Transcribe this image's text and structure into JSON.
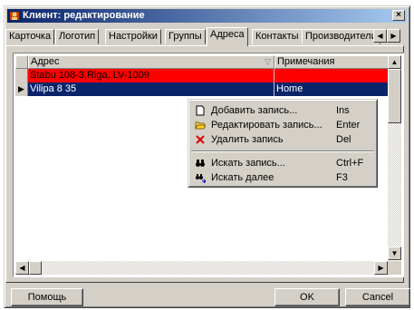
{
  "window": {
    "title": "Клиент: редактирование"
  },
  "tabs": [
    {
      "label": "Карточка"
    },
    {
      "label": "Логотип"
    },
    {
      "label": "Настройки"
    },
    {
      "label": "Группы"
    },
    {
      "label": "Адреса",
      "active": true
    },
    {
      "label": "Контакты"
    },
    {
      "label": "Производители"
    }
  ],
  "grid": {
    "columns": [
      "Адрес",
      "Примечания"
    ],
    "rows": [
      {
        "address": "Stabu 108-3,Riga, LV-1009",
        "note": "",
        "style": "red"
      },
      {
        "address": "Vilipa 8 35",
        "note": "Home",
        "style": "selected"
      }
    ]
  },
  "context_menu": {
    "items": [
      {
        "label": "Добавить запись...",
        "shortcut": "Ins",
        "icon": "new-document-icon"
      },
      {
        "label": "Редактировать запись...",
        "shortcut": "Enter",
        "icon": "open-folder-icon"
      },
      {
        "label": "Удалить запись",
        "shortcut": "Del",
        "icon": "delete-x-icon"
      },
      {
        "label": "Искать запись...",
        "shortcut": "Ctrl+F",
        "icon": "binoculars-icon"
      },
      {
        "label": "Искать далее",
        "shortcut": "F3",
        "icon": "binoculars-next-icon"
      }
    ]
  },
  "buttons": {
    "help": "Помощь",
    "ok": "OK",
    "cancel": "Cancel"
  },
  "colors": {
    "red_row": "#ff0000",
    "selected_row": "#0a246a",
    "title_start": "#0a246a",
    "title_end": "#a6caf0"
  }
}
